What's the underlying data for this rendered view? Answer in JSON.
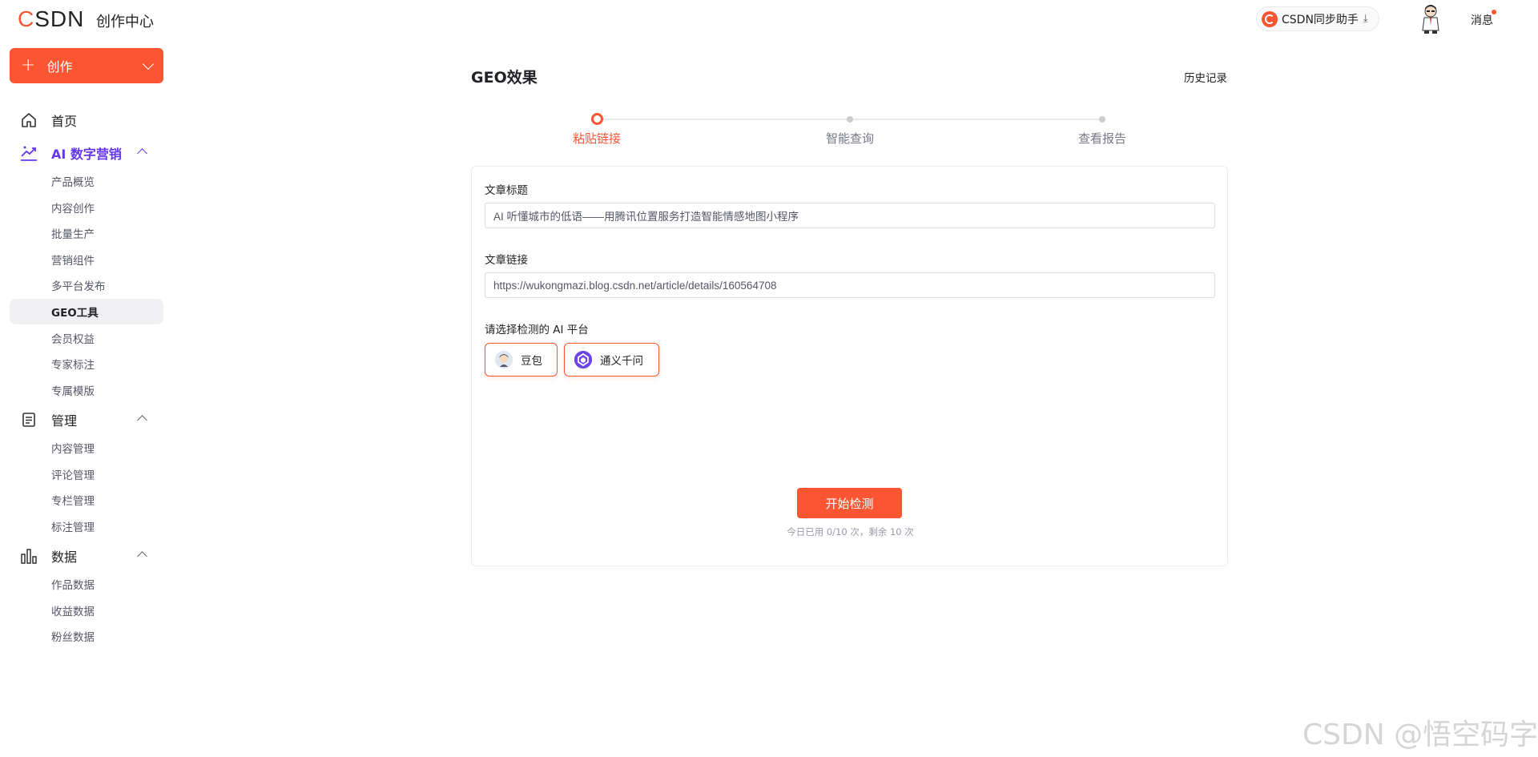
{
  "header": {
    "logo": "CSDN",
    "subtitle": "创作中心",
    "sync_button": "CSDN同步助手",
    "messages": "消息"
  },
  "sidebar": {
    "create_label": "创作",
    "home": "首页",
    "sections": [
      {
        "label": "AI 数字营销",
        "items": [
          "产品概览",
          "内容创作",
          "批量生产",
          "营销组件",
          "多平台发布",
          "GEO工具",
          "会员权益",
          "专家标注",
          "专属模版"
        ]
      },
      {
        "label": "管理",
        "items": [
          "内容管理",
          "评论管理",
          "专栏管理",
          "标注管理"
        ]
      },
      {
        "label": "数据",
        "items": [
          "作品数据",
          "收益数据",
          "粉丝数据"
        ]
      }
    ],
    "active_item": "GEO工具"
  },
  "main": {
    "title": "GEO效果",
    "history": "历史记录",
    "steps": [
      "粘贴链接",
      "智能查询",
      "查看报告"
    ],
    "active_step": 0,
    "form": {
      "title_label": "文章标题",
      "title_value": "AI 听懂城市的低语——用腾讯位置服务打造智能情感地图小程序",
      "link_label": "文章链接",
      "link_value": "https://wukongmazi.blog.csdn.net/article/details/160564708",
      "platform_label": "请选择检测的 AI 平台",
      "platforms": [
        "豆包",
        "通义千问"
      ]
    },
    "start_button": "开始检测",
    "quota": "今日已用 0/10 次，剩余 10 次"
  },
  "watermark": "CSDN @悟空码字",
  "colors": {
    "accent": "#fc5531",
    "ai_section": "#6436f0"
  }
}
